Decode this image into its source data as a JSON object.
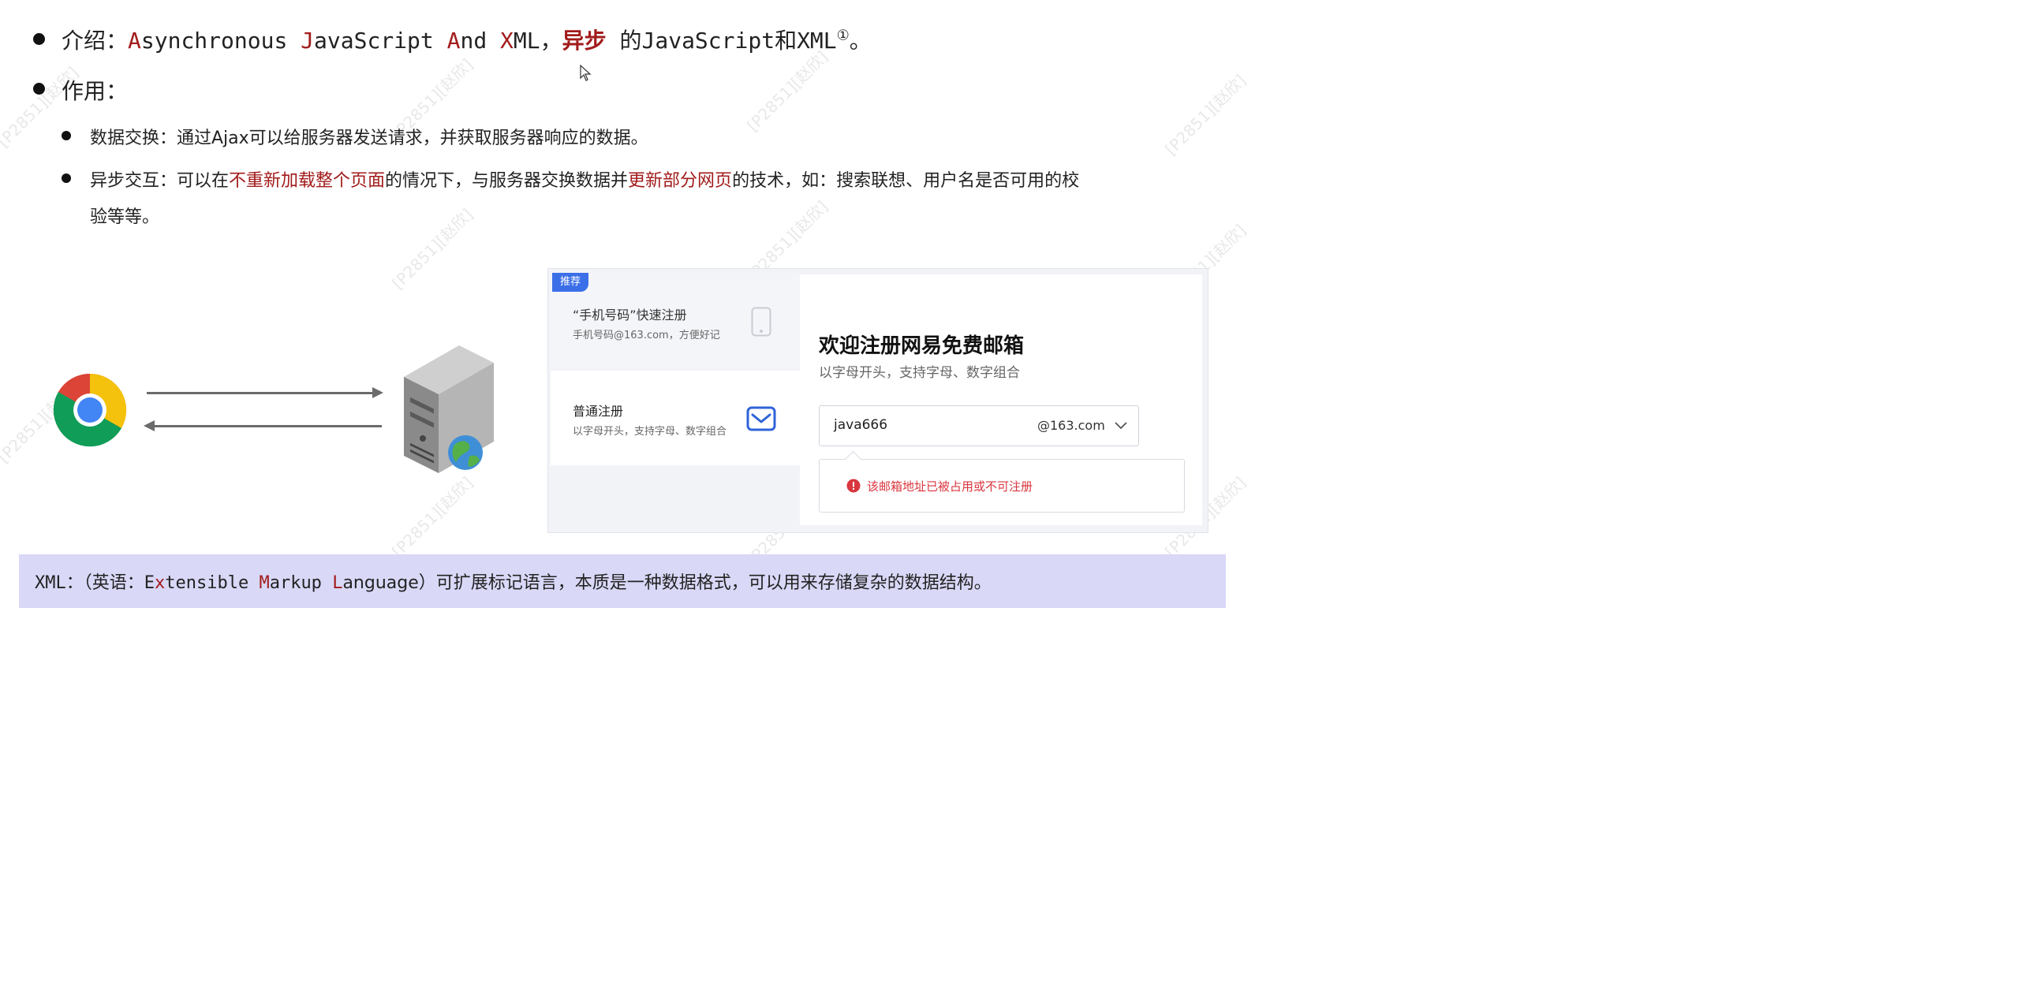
{
  "intro": {
    "label": "介绍：",
    "a1": "A",
    "a1_rest": "synchronous ",
    "a2": "J",
    "a2_rest": "avaScript ",
    "a3": "A",
    "a3_rest": "nd ",
    "a4": "X",
    "a4_rest": "ML，",
    "async": "异步",
    "tail": " 的JavaScript和XML",
    "sup": "①",
    "end": "。"
  },
  "usage": {
    "label": "作用：",
    "item1": "数据交换：通过Ajax可以给服务器发送请求，并获取服务器响应的数据。",
    "item2_a": "异步交互：可以在",
    "item2_b": "不重新加载整个页面",
    "item2_c": "的情况下，与服务器交换数据并",
    "item2_d": "更新部分网页",
    "item2_e": "的技术，如：搜索联想、用户名是否可用的校",
    "item2_f": "验等等。"
  },
  "register": {
    "tag": "推荐",
    "opt1_title": "“手机号码”快速注册",
    "opt1_sub": "手机号码@163.com，方便好记",
    "opt2_title": "普通注册",
    "opt2_sub": "以字母开头，支持字母、数字组合",
    "heading": "欢迎注册网易免费邮箱",
    "subheading": "以字母开头，支持字母、数字组合",
    "input_value": "java666",
    "domain": "@163.com",
    "error": "该邮箱地址已被占用或不可注册"
  },
  "footer": {
    "a": "XML：（英语：E",
    "x": "x",
    "b": "tensible ",
    "m": "M",
    "c": "arkup ",
    "l": "L",
    "d": "anguage）可扩展标记语言，本质是一种数据格式，可以用来存储复杂的数据结构。"
  },
  "icons": {
    "browser": "chrome-icon",
    "server": "server-icon",
    "phone": "phone-icon",
    "mail": "mail-icon",
    "error": "error-icon",
    "chevron": "chevron-down-icon",
    "cursor": "mouse-cursor-icon"
  },
  "watermark": "[P2851][赵欣]",
  "colors": {
    "accent_red": "#a21b1b",
    "tag_blue": "#3b6fe8",
    "footer_bg": "#d9d8f7",
    "error_red": "#d9363e"
  }
}
